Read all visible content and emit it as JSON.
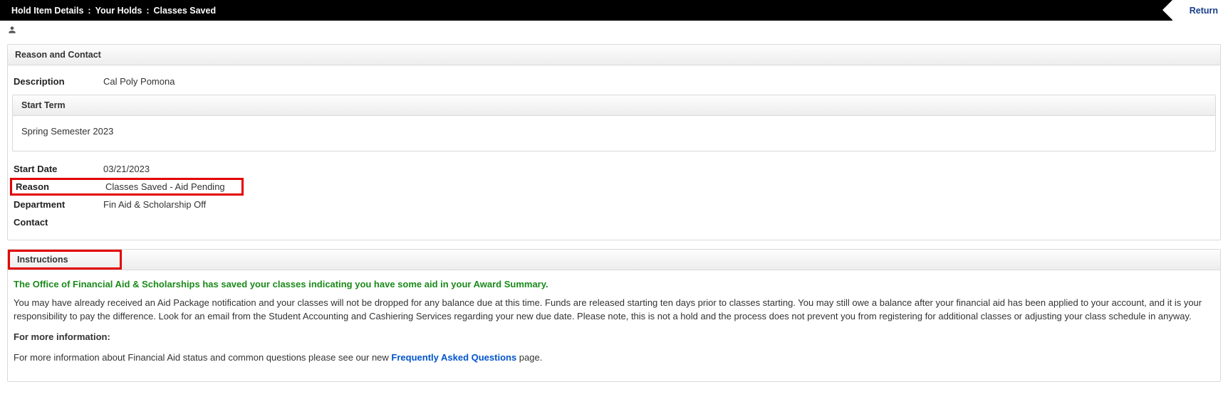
{
  "breadcrumb": {
    "item1": "Hold Item Details",
    "item2": "Your Holds",
    "item3": "Classes Saved"
  },
  "return_label": "Return",
  "reason_panel": {
    "header": "Reason and Contact",
    "description_label": "Description",
    "description_value": "Cal Poly Pomona",
    "start_term_header": "Start Term",
    "start_term_value": "Spring Semester 2023",
    "start_date_label": "Start Date",
    "start_date_value": "03/21/2023",
    "reason_label": "Reason",
    "reason_value": "Classes Saved - Aid Pending",
    "department_label": "Department",
    "department_value": "Fin Aid & Scholarship Off",
    "contact_label": "Contact",
    "contact_value": ""
  },
  "instructions_panel": {
    "header": "Instructions",
    "headline": "The Office of Financial Aid & Scholarships has saved your classes indicating you have some aid in your Award Summary.",
    "body1": "You may have already received an Aid Package notification and your classes will not be dropped for any balance due at this time. Funds are released starting ten days prior to classes starting. You may still owe a balance after your financial aid has been applied to your account, and it is your responsibility to pay the difference. Look for an email from the Student Accounting and Cashiering Services regarding your new due date. Please note, this is not a hold and the process does not prevent you from registering for additional classes or adjusting your class schedule in anyway.",
    "more_info_label": "For more information:",
    "body2_pre": "For more information about Financial Aid status and common questions please see our new ",
    "faq_link": "Frequently Asked Questions",
    "body2_post": " page."
  }
}
